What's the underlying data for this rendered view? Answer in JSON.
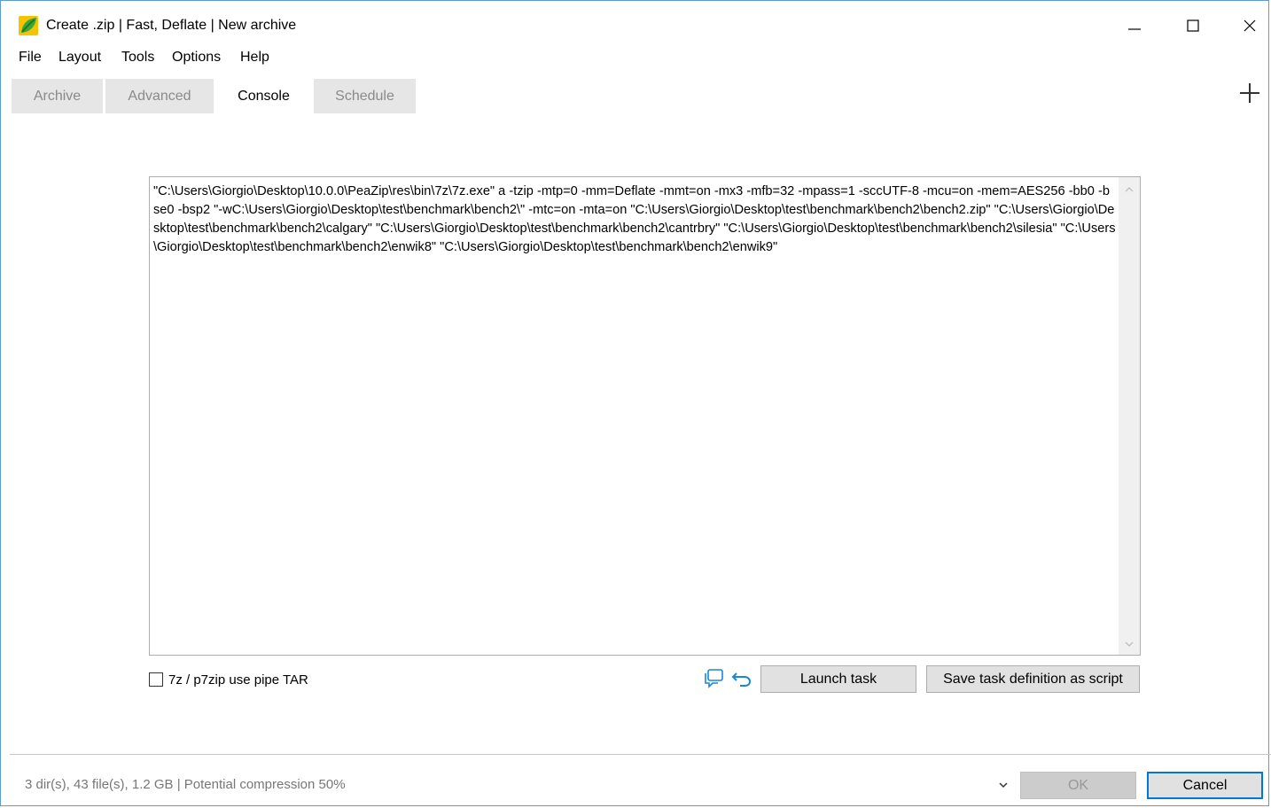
{
  "window": {
    "title": "Create .zip | Fast, Deflate | New archive",
    "icon": "peazip-leaf-icon"
  },
  "menu": [
    "File",
    "Layout",
    "Tools",
    "Options",
    "Help"
  ],
  "tabs": [
    {
      "label": "Archive",
      "active": false
    },
    {
      "label": "Advanced",
      "active": false
    },
    {
      "label": "Console",
      "active": true
    },
    {
      "label": "Schedule",
      "active": false
    }
  ],
  "console": {
    "command": "\"C:\\Users\\Giorgio\\Desktop\\10.0.0\\PeaZip\\res\\bin\\7z\\7z.exe\" a -tzip -mtp=0 -mm=Deflate -mmt=on -mx3 -mfb=32 -mpass=1 -sccUTF-8 -mcu=on -mem=AES256 -bb0 -bse0 -bsp2 \"-wC:\\Users\\Giorgio\\Desktop\\test\\benchmark\\bench2\\\" -mtc=on -mta=on \"C:\\Users\\Giorgio\\Desktop\\test\\benchmark\\bench2\\bench2.zip\" \"C:\\Users\\Giorgio\\Desktop\\test\\benchmark\\bench2\\calgary\" \"C:\\Users\\Giorgio\\Desktop\\test\\benchmark\\bench2\\cantrbry\" \"C:\\Users\\Giorgio\\Desktop\\test\\benchmark\\bench2\\silesia\" \"C:\\Users\\Giorgio\\Desktop\\test\\benchmark\\bench2\\enwik8\" \"C:\\Users\\Giorgio\\Desktop\\test\\benchmark\\bench2\\enwik9\""
  },
  "options": {
    "pipe_tar_label": "7z / p7zip use pipe TAR",
    "pipe_tar_checked": false
  },
  "actions": {
    "launch_label": "Launch task",
    "save_script_label": "Save task definition as script"
  },
  "footer": {
    "status": "3 dir(s), 43 file(s), 1.2 GB | Potential compression 50%",
    "ok_label": "OK",
    "cancel_label": "Cancel"
  },
  "colors": {
    "accent": "#0078d7",
    "icon_blue": "#1a86d9",
    "tab_inactive": "#e6e6e6"
  }
}
